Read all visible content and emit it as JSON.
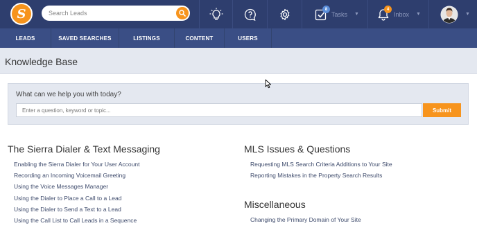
{
  "topbar": {
    "logo_letter": "S",
    "search": {
      "placeholder": "Search Leads"
    },
    "tasks": {
      "label": "Tasks",
      "badge": "8"
    },
    "inbox": {
      "label": "Inbox",
      "badge": "4"
    },
    "icons": [
      "lightbulb-icon",
      "help-icon",
      "gear-icon",
      "tasks-check-icon",
      "bell-icon"
    ]
  },
  "nav": {
    "items": [
      {
        "label": "LEADS"
      },
      {
        "label": "SAVED SEARCHES"
      },
      {
        "label": "LISTINGS"
      },
      {
        "label": "CONTENT"
      },
      {
        "label": "USERS"
      }
    ]
  },
  "page": {
    "title": "Knowledge Base"
  },
  "help": {
    "question": "What can we help you with today?",
    "placeholder": "Enter a question, keyword or topic...",
    "submit": "Submit"
  },
  "sections": [
    {
      "title": "The Sierra Dialer & Text Messaging",
      "links": [
        "Enabling the Sierra Dialer for Your User Account",
        "Recording an Incoming Voicemail Greeting",
        "Using the Voice Messages Manager",
        "Using the Dialer to Place a Call to a Lead",
        "Using the Dialer to Send a Text to a Lead",
        "Using the Call List to Call Leads in a Sequence"
      ]
    },
    {
      "title": "MLS Issues & Questions",
      "links": [
        "Requesting MLS Search Criteria Additions to Your Site",
        "Reporting Mistakes in the Property Search Results"
      ]
    },
    {
      "title": "Miscellaneous",
      "links": [
        "Changing the Primary Domain of Your Site"
      ]
    }
  ],
  "colors": {
    "topbar": "#2e3e6e",
    "navbar": "#3a4e85",
    "accent": "#f7941d",
    "badge_tasks": "#5b8dd9",
    "badge_inbox": "#f7941d"
  }
}
